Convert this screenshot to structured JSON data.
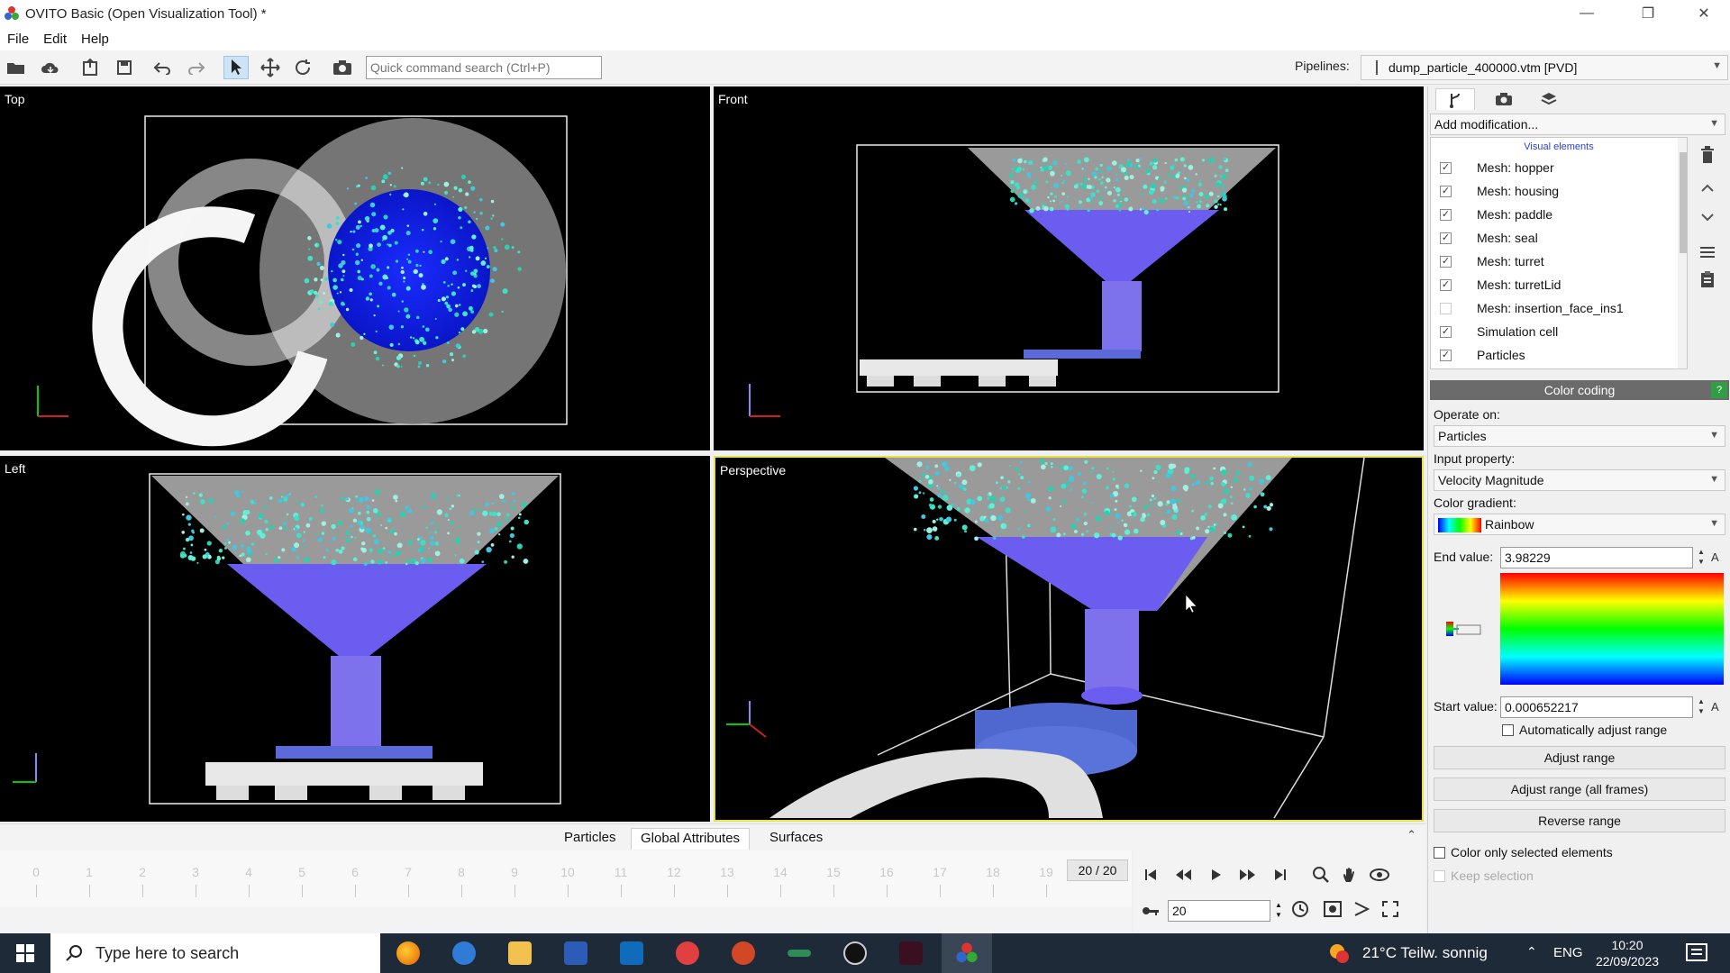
{
  "window": {
    "title": "OVITO Basic (Open Visualization Tool) *"
  },
  "menu": [
    "File",
    "Edit",
    "Help"
  ],
  "toolbar": {
    "search_placeholder": "Quick command search (Ctrl+P)",
    "pipelines_label": "Pipelines:",
    "pipeline_value": "dump_particle_400000.vtm [PVD]"
  },
  "viewports": {
    "top": "Top",
    "front": "Front",
    "left": "Left",
    "perspective": "Perspective"
  },
  "data_tabs": [
    "Particles",
    "Global Attributes",
    "Surfaces"
  ],
  "timeline": {
    "ticks": [
      "0",
      "1",
      "2",
      "3",
      "4",
      "5",
      "6",
      "7",
      "8",
      "9",
      "10",
      "11",
      "12",
      "13",
      "14",
      "15",
      "16",
      "17",
      "18",
      "19"
    ],
    "frame_display": "20 / 20",
    "current_frame": "20"
  },
  "panel": {
    "add_modification": "Add modification...",
    "list_header": "Visual elements",
    "items": [
      {
        "label": "Mesh: hopper",
        "checked": "✓"
      },
      {
        "label": "Mesh: housing",
        "checked": "✓"
      },
      {
        "label": "Mesh: paddle",
        "checked": "✓"
      },
      {
        "label": "Mesh: seal",
        "checked": "✓"
      },
      {
        "label": "Mesh: turret",
        "checked": "✓"
      },
      {
        "label": "Mesh: turretLid",
        "checked": "✓"
      },
      {
        "label": "Mesh: insertion_face_ins1",
        "checked": ""
      },
      {
        "label": "Simulation cell",
        "checked": "✓"
      },
      {
        "label": "Particles",
        "checked": "✓"
      }
    ],
    "color_coding": {
      "title": "Color coding",
      "help": "?",
      "operate_on_label": "Operate on:",
      "operate_on": "Particles",
      "input_property_label": "Input property:",
      "input_property": "Velocity Magnitude",
      "gradient_label": "Color gradient:",
      "gradient": "Rainbow",
      "end_label": "End value:",
      "end_value": "3.98229",
      "start_label": "Start value:",
      "start_value": "0.000652217",
      "unit": "A",
      "auto_adjust": "Automatically adjust range",
      "adjust_range": "Adjust range",
      "adjust_range_all": "Adjust range (all frames)",
      "reverse_range": "Reverse range",
      "color_only_selected": "Color only selected elements",
      "keep_selection": "Keep selection"
    }
  },
  "taskbar": {
    "search": "Type here to search",
    "weather": "21°C  Teilw. sonnig",
    "lang": "ENG",
    "time": "10:20",
    "date": "22/09/2023"
  }
}
